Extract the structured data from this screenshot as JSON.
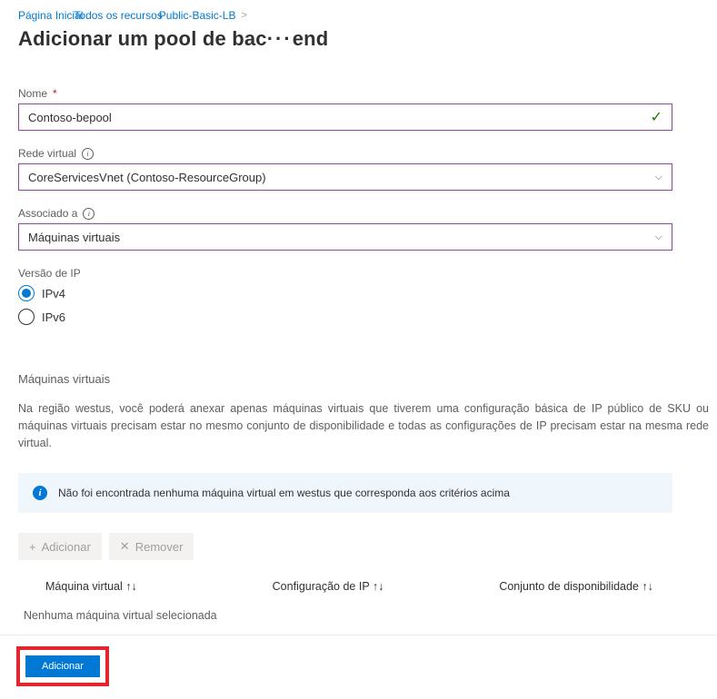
{
  "breadcrumb": {
    "home": "Página Inicial",
    "all_resources": "Todos os recursos",
    "resource": "Public-Basic-LB"
  },
  "page_title_pre": "Adicionar um pool de bac",
  "page_title_dots": "···",
  "page_title_post": "end",
  "fields": {
    "name": {
      "label": "Nome",
      "value": "Contoso-bepool"
    },
    "vnet": {
      "label": "Rede virtual",
      "value": "CoreServicesVnet (Contoso-ResourceGroup)"
    },
    "associated": {
      "label": "Associado a",
      "value": "Máquinas virtuais"
    },
    "ipversion": {
      "label": "Versão de IP",
      "options": [
        "IPv4",
        "IPv6"
      ],
      "selected": "IPv4"
    }
  },
  "vm_section": {
    "title": "Máquinas virtuais",
    "description": "Na região westus, você poderá anexar apenas máquinas virtuais que tiverem uma configuração básica de IP público de SKU ou máquinas virtuais precisam estar no mesmo conjunto de disponibilidade e todas as configurações de IP precisam estar na mesma rede virtual.",
    "banner": "Não foi encontrada nenhuma máquina virtual em westus que corresponda aos critérios acima",
    "add_btn": "Adicionar",
    "remove_btn": "Remover",
    "columns": {
      "vm": "Máquina virtual ↑↓",
      "ipconfig": "Configuração de IP ↑↓",
      "avset": "Conjunto de disponibilidade ↑↓"
    },
    "empty": "Nenhuma máquina virtual selecionada"
  },
  "footer": {
    "add": "Adicionar"
  }
}
